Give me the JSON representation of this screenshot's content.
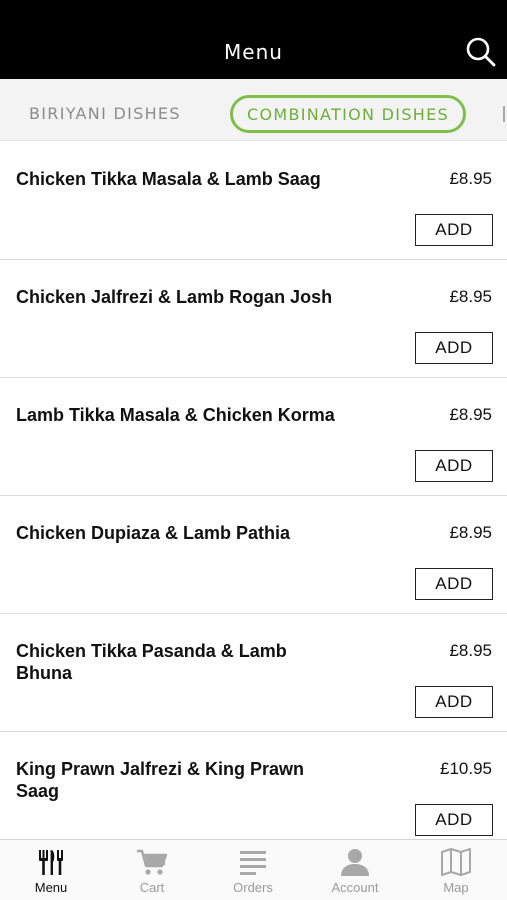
{
  "header": {
    "title": "Menu",
    "search_icon": "search-icon"
  },
  "tabs": [
    {
      "label": "BIRIYANI DISHES"
    },
    {
      "label": "COMBINATION DISHES",
      "active": true
    }
  ],
  "accent_color": "#7dbf4a",
  "items": [
    {
      "name": "Chicken Tikka Masala & Lamb Saag",
      "price": "£8.95",
      "add_label": "ADD"
    },
    {
      "name": "Chicken Jalfrezi & Lamb Rogan Josh",
      "price": "£8.95",
      "add_label": "ADD"
    },
    {
      "name": "Lamb Tikka Masala & Chicken Korma",
      "price": "£8.95",
      "add_label": "ADD"
    },
    {
      "name": "Chicken Dupiaza & Lamb Pathia",
      "price": "£8.95",
      "add_label": "ADD"
    },
    {
      "name": "Chicken Tikka Pasanda & Lamb Bhuna",
      "price": "£8.95",
      "add_label": "ADD"
    },
    {
      "name": "King Prawn Jalfrezi & King Prawn Saag",
      "price": "£10.95",
      "add_label": "ADD"
    }
  ],
  "bottom_nav": [
    {
      "label": "Menu",
      "icon": "fork-knife-icon",
      "active": true
    },
    {
      "label": "Cart",
      "icon": "cart-icon"
    },
    {
      "label": "Orders",
      "icon": "list-icon"
    },
    {
      "label": "Account",
      "icon": "person-icon"
    },
    {
      "label": "Map",
      "icon": "map-icon"
    }
  ]
}
